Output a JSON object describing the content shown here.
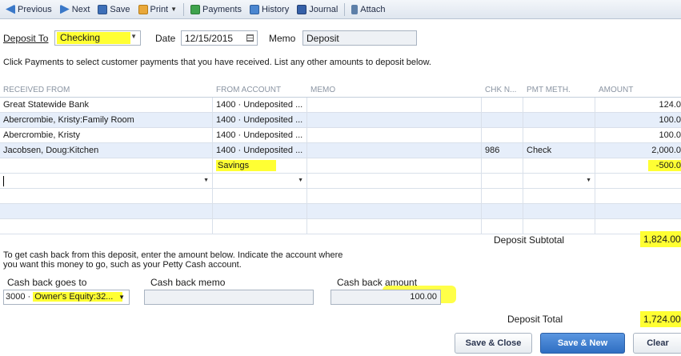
{
  "toolbar": {
    "previous": "Previous",
    "next": "Next",
    "save": "Save",
    "print": "Print",
    "payments": "Payments",
    "history": "History",
    "journal": "Journal",
    "attach": "Attach"
  },
  "header": {
    "deposit_to_label": "Deposit To",
    "deposit_to_value": "Checking",
    "date_label": "Date",
    "date_value": "12/15/2015",
    "memo_label": "Memo",
    "memo_value": "Deposit"
  },
  "instructions": "Click Payments to select customer payments that you have received. List any other amounts to deposit below.",
  "grid": {
    "columns": [
      "RECEIVED FROM",
      "FROM ACCOUNT",
      "MEMO",
      "CHK N...",
      "PMT METH.",
      "AMOUNT"
    ],
    "rows": [
      {
        "received_from": "Great Statewide Bank",
        "from_account": "1400 · Undeposited ...",
        "memo": "",
        "chk_no": "",
        "pmt_meth": "",
        "amount": "124.0"
      },
      {
        "received_from": "Abercrombie, Kristy:Family Room",
        "from_account": "1400 · Undeposited ...",
        "memo": "",
        "chk_no": "",
        "pmt_meth": "",
        "amount": "100.0"
      },
      {
        "received_from": "Abercrombie, Kristy",
        "from_account": "1400 · Undeposited ...",
        "memo": "",
        "chk_no": "",
        "pmt_meth": "",
        "amount": "100.0"
      },
      {
        "received_from": "Jacobsen, Doug:Kitchen",
        "from_account": "1400 · Undeposited ...",
        "memo": "",
        "chk_no": "986",
        "pmt_meth": "Check",
        "amount": "2,000.0"
      },
      {
        "received_from": "",
        "from_account": "Savings",
        "memo": "",
        "chk_no": "",
        "pmt_meth": "",
        "amount": "-500.0"
      }
    ]
  },
  "totals": {
    "subtotal_label": "Deposit Subtotal",
    "subtotal_value": "1,824.00",
    "total_label": "Deposit Total",
    "total_value": "1,724.00"
  },
  "cash_back": {
    "instructions_line1": "To get cash back from this deposit, enter the amount below.  Indicate the account where",
    "instructions_line2": "you want this money to go, such as your Petty Cash account.",
    "goes_to_label": "Cash back goes to",
    "account_number": "3000 ·",
    "account_name": "Owner's Equity:32...",
    "memo_label": "Cash back memo",
    "memo_value": "",
    "amount_label": "Cash back amount",
    "amount_value": "100.00"
  },
  "buttons": {
    "save_close": "Save & Close",
    "save_new": "Save & New",
    "clear": "Clear"
  },
  "colors": {
    "highlight": "#ffff33",
    "alt_row": "#e6eefa",
    "primary_button": "#2f6ec2"
  }
}
